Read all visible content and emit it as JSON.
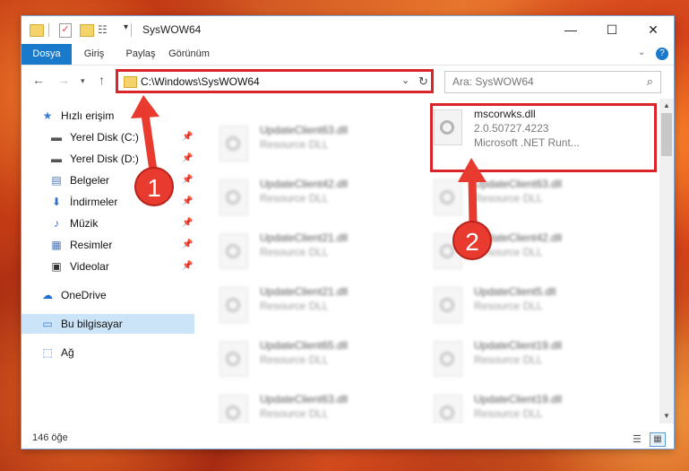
{
  "window": {
    "title": "SysWOW64",
    "buttons": {
      "minimize": "—",
      "maximize": "☐",
      "close": "✕"
    }
  },
  "quick_access_toolbar": {
    "dropdown": "▾"
  },
  "ribbon": {
    "tabs": [
      "Dosya",
      "Giriş",
      "Paylaş",
      "Görünüm"
    ],
    "expand": "⌄",
    "help": "?"
  },
  "nav": {
    "back": "←",
    "forward": "→",
    "recent": "▾",
    "up": "↑",
    "address": "C:\\Windows\\SysWOW64",
    "address_dropdown": "⌄",
    "refresh": "↻",
    "search_placeholder": "Ara: SysWOW64",
    "search_icon": "⌕"
  },
  "sidebar": {
    "items": [
      {
        "label": "Hızlı erişim",
        "icon": "star-icon",
        "glyph": "★",
        "color": "#3a7bd5"
      },
      {
        "label": "Yerel Disk (C:)",
        "icon": "drive-icon",
        "glyph": "▬",
        "color": "#555555",
        "pinned": true
      },
      {
        "label": "Yerel Disk (D:)",
        "icon": "drive-icon",
        "glyph": "▬",
        "color": "#555555",
        "pinned": true
      },
      {
        "label": "Belgeler",
        "icon": "documents-icon",
        "glyph": "▤",
        "color": "#4a74b8",
        "pinned": true
      },
      {
        "label": "İndirmeler",
        "icon": "downloads-icon",
        "glyph": "⬇",
        "color": "#2f6fc7",
        "pinned": true
      },
      {
        "label": "Müzik",
        "icon": "music-icon",
        "glyph": "♪",
        "color": "#2f6fc7",
        "pinned": true
      },
      {
        "label": "Resimler",
        "icon": "pictures-icon",
        "glyph": "▦",
        "color": "#4a74b8",
        "pinned": true
      },
      {
        "label": "Videolar",
        "icon": "videos-icon",
        "glyph": "▣",
        "color": "#333333",
        "pinned": true
      },
      {
        "label": "OneDrive",
        "icon": "cloud-icon",
        "glyph": "☁",
        "color": "#1f6fd1"
      },
      {
        "label": "Bu bilgisayar",
        "icon": "computer-icon",
        "glyph": "▭",
        "color": "#3a7bd5",
        "selected": true
      },
      {
        "label": "Ağ",
        "icon": "network-icon",
        "glyph": "⬚",
        "color": "#3a7bd5"
      }
    ],
    "pin_glyph": "📌"
  },
  "files": {
    "left": [
      {
        "name": "UpdateClient63.dll",
        "type": "Resource DLL"
      },
      {
        "name": "UpdateClient42.dll",
        "type": "Resource DLL"
      },
      {
        "name": "UpdateClient21.dll",
        "type": "Resource DLL"
      },
      {
        "name": "UpdateClient21.dll",
        "type": "Resource DLL"
      },
      {
        "name": "UpdateClient65.dll",
        "type": "Resource DLL"
      },
      {
        "name": "UpdateClient63.dll",
        "type": "Resource DLL"
      }
    ],
    "featured": {
      "name": "mscorwks.dll",
      "version": "2.0.50727.4223",
      "description": "Microsoft .NET Runt..."
    },
    "right": [
      {
        "name": "UpdateClient63.dll",
        "type": "Resource DLL"
      },
      {
        "name": "UpdateClient42.dll",
        "type": "Resource DLL"
      },
      {
        "name": "UpdateClient5.dll",
        "type": "Resource DLL"
      },
      {
        "name": "UpdateClient19.dll",
        "type": "Resource DLL"
      },
      {
        "name": "UpdateClient19.dll",
        "type": "Resource DLL"
      }
    ]
  },
  "scrollbar": {
    "up": "▲",
    "down": "▼"
  },
  "status": {
    "count": "146 öğe",
    "details_view": "☰",
    "tiles_view": "▦"
  },
  "annotations": {
    "badge1": "1",
    "badge2": "2",
    "color": "#e83a2e"
  }
}
